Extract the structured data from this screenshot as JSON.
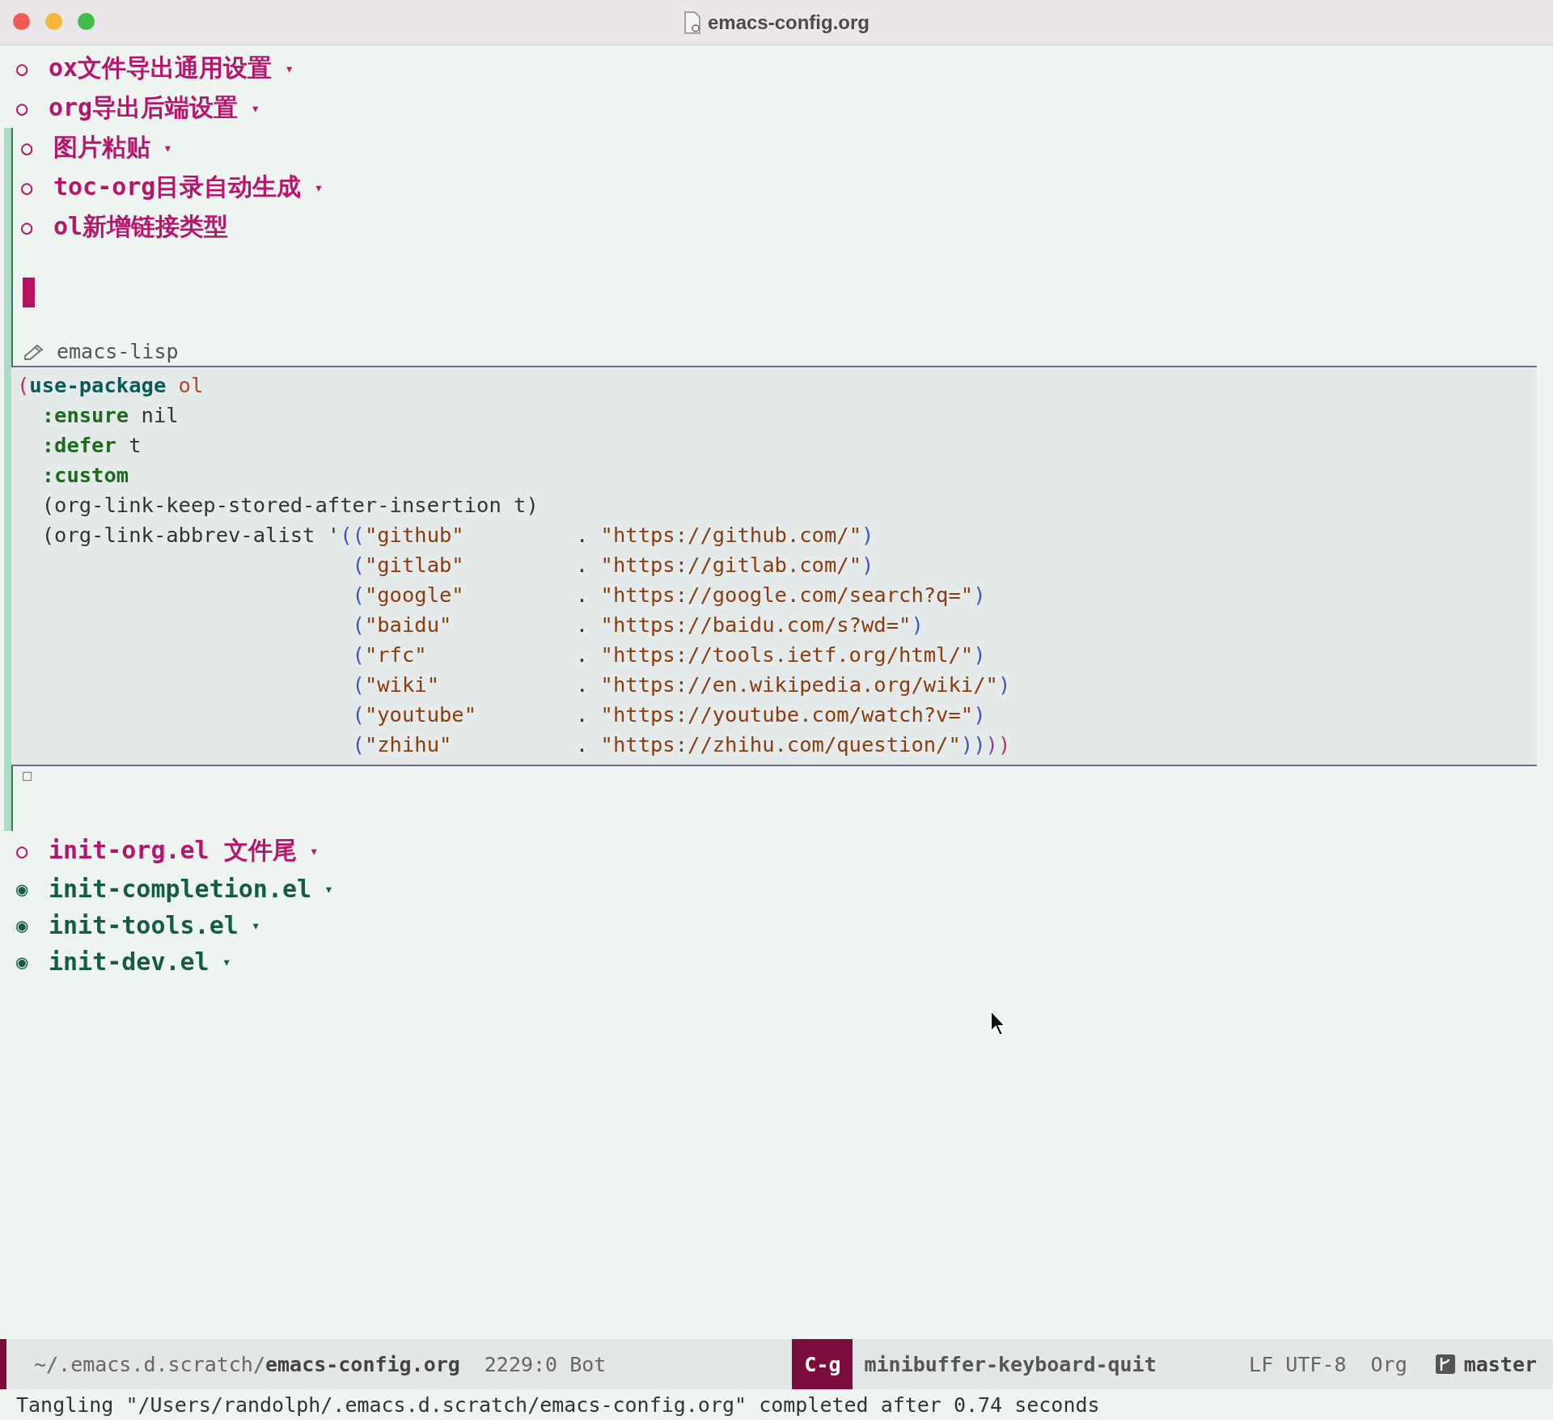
{
  "window": {
    "title": "emacs-config.org"
  },
  "document": [
    {
      "kind": "subheading",
      "bullet": "○",
      "text": "ox文件导出通用设置",
      "fold_marker": "▾",
      "modified": false
    },
    {
      "kind": "subheading",
      "bullet": "○",
      "text": "org导出后端设置",
      "fold_marker": "▾",
      "modified": false
    },
    {
      "kind": "subheading",
      "bullet": "○",
      "text": "图片粘贴",
      "fold_marker": "▾",
      "modified": true
    },
    {
      "kind": "subheading",
      "bullet": "○",
      "text": "toc-org目录自动生成",
      "fold_marker": "▾",
      "modified": true
    },
    {
      "kind": "subheading",
      "bullet": "○",
      "text": "ol新增链接类型",
      "modified": true
    },
    {
      "kind": "cursor"
    },
    {
      "kind": "src_block",
      "language": "emacs-lisp",
      "modified": true,
      "lines": [
        [
          {
            "kind": "paren_a",
            "text": "("
          },
          {
            "kind": "keyword",
            "text": "use-package"
          },
          {
            "kind": "symbol",
            "text": " ol"
          }
        ],
        [
          {
            "kind": "property",
            "text": "  :ensure"
          },
          {
            "kind": "plain",
            "text": " nil"
          }
        ],
        [
          {
            "kind": "property",
            "text": "  :defer"
          },
          {
            "kind": "plain",
            "text": " t"
          }
        ],
        [
          {
            "kind": "property",
            "text": "  :custom"
          }
        ],
        [
          {
            "kind": "plain",
            "text": "  (org-link-keep-stored-after-insertion t)"
          }
        ],
        [
          {
            "kind": "plain",
            "text": "  (org-link-abbrev-alist '"
          },
          {
            "kind": "paren_b",
            "text": "(("
          },
          {
            "kind": "string",
            "text": "\"github\""
          },
          {
            "kind": "plain",
            "text": "         . "
          },
          {
            "kind": "string",
            "text": "\"https://github.com/\""
          },
          {
            "kind": "paren_b",
            "text": ")"
          }
        ],
        [
          {
            "kind": "paren_b",
            "text": "                           ("
          },
          {
            "kind": "string",
            "text": "\"gitlab\""
          },
          {
            "kind": "plain",
            "text": "         . "
          },
          {
            "kind": "string",
            "text": "\"https://gitlab.com/\""
          },
          {
            "kind": "paren_b",
            "text": ")"
          }
        ],
        [
          {
            "kind": "paren_b",
            "text": "                           ("
          },
          {
            "kind": "string",
            "text": "\"google\""
          },
          {
            "kind": "plain",
            "text": "         . "
          },
          {
            "kind": "string",
            "text": "\"https://google.com/search?q=\""
          },
          {
            "kind": "paren_b",
            "text": ")"
          }
        ],
        [
          {
            "kind": "paren_b",
            "text": "                           ("
          },
          {
            "kind": "string",
            "text": "\"baidu\""
          },
          {
            "kind": "plain",
            "text": "          . "
          },
          {
            "kind": "string",
            "text": "\"https://baidu.com/s?wd=\""
          },
          {
            "kind": "paren_b",
            "text": ")"
          }
        ],
        [
          {
            "kind": "paren_b",
            "text": "                           ("
          },
          {
            "kind": "string",
            "text": "\"rfc\""
          },
          {
            "kind": "plain",
            "text": "            . "
          },
          {
            "kind": "string",
            "text": "\"https://tools.ietf.org/html/\""
          },
          {
            "kind": "paren_b",
            "text": ")"
          }
        ],
        [
          {
            "kind": "paren_b",
            "text": "                           ("
          },
          {
            "kind": "string",
            "text": "\"wiki\""
          },
          {
            "kind": "plain",
            "text": "           . "
          },
          {
            "kind": "string",
            "text": "\"https://en.wikipedia.org/wiki/\""
          },
          {
            "kind": "paren_b",
            "text": ")"
          }
        ],
        [
          {
            "kind": "paren_b",
            "text": "                           ("
          },
          {
            "kind": "string",
            "text": "\"youtube\""
          },
          {
            "kind": "plain",
            "text": "        . "
          },
          {
            "kind": "string",
            "text": "\"https://youtube.com/watch?v=\""
          },
          {
            "kind": "paren_b",
            "text": ")"
          }
        ],
        [
          {
            "kind": "paren_b",
            "text": "                           ("
          },
          {
            "kind": "string",
            "text": "\"zhihu\""
          },
          {
            "kind": "plain",
            "text": "          . "
          },
          {
            "kind": "string",
            "text": "\"https://zhihu.com/question/\""
          },
          {
            "kind": "paren_b",
            "text": "))"
          },
          {
            "kind": "paren_c",
            "text": ")"
          },
          {
            "kind": "paren_a",
            "text": ")"
          }
        ]
      ]
    },
    {
      "kind": "result_marker",
      "text": "□",
      "modified": true
    },
    {
      "kind": "subheading",
      "bullet": "○",
      "text": "init-org.el 文件尾",
      "fold_marker": "▾",
      "modified": false
    },
    {
      "kind": "heading",
      "bullet": "◉",
      "text": "init-completion.el",
      "fold_marker": "▾",
      "modified": false
    },
    {
      "kind": "heading",
      "bullet": "◉",
      "text": "init-tools.el",
      "fold_marker": "▾",
      "modified": false
    },
    {
      "kind": "heading",
      "bullet": "◉",
      "text": "init-dev.el",
      "fold_marker": "▾",
      "modified": false
    }
  ],
  "mode_line": {
    "directory": "~/.emacs.d.scratch/",
    "file": "emacs-config.org",
    "position": "2229:0 Bot",
    "key": "C-g",
    "command": "minibuffer-keyboard-quit",
    "encoding": "LF UTF-8",
    "major_mode": "Org",
    "branch": "master"
  },
  "echo_area": "Tangling \"/Users/randolph/.emacs.d.scratch/emacs-config.org\" completed after 0.74 seconds"
}
